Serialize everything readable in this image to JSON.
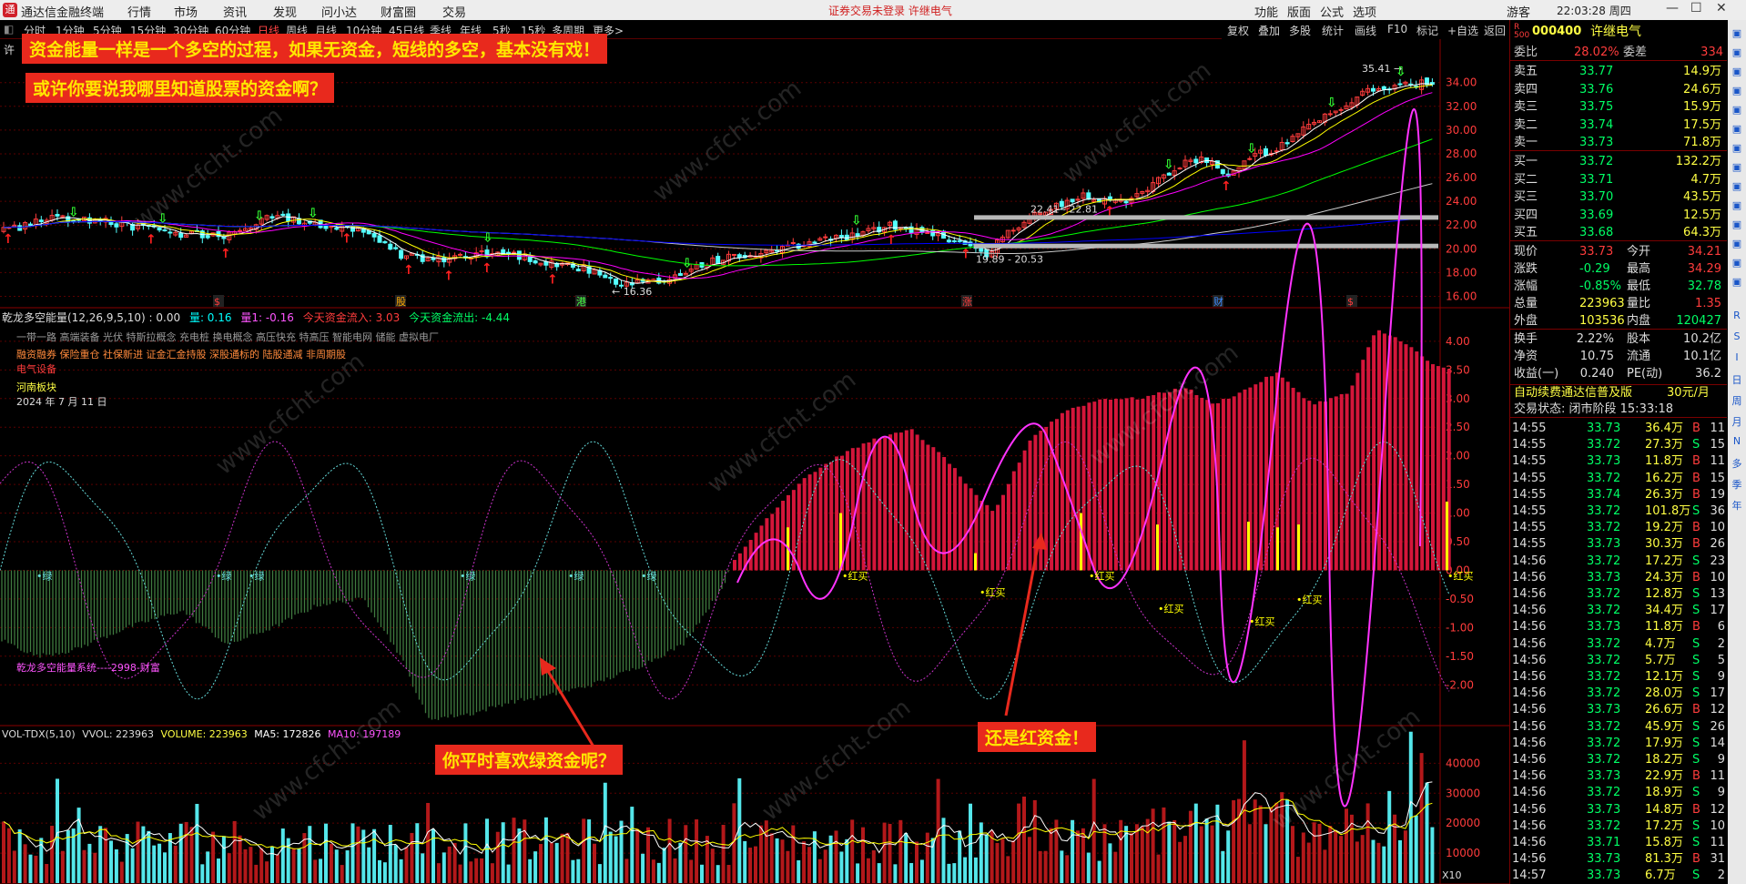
{
  "app": {
    "name": "通达信金融终端",
    "notice": "证券交易未登录  许继电气",
    "clock": "22:03:28 周四"
  },
  "menu": [
    "行情",
    "市场",
    "资讯",
    "发现",
    "问小达",
    "财富圈",
    "交易"
  ],
  "right_menu": [
    "功能",
    "版面",
    "公式",
    "选项",
    "游客"
  ],
  "periods": [
    "分时",
    "1分钟",
    "5分钟",
    "15分钟",
    "30分钟",
    "60分钟",
    "日线",
    "周线",
    "月线",
    "10分钟",
    "45日线",
    "季线",
    "年线",
    "5秒",
    "15秒",
    "多周期",
    "更多>"
  ],
  "active_period": "日线",
  "toolbar": [
    "复权",
    "叠加",
    "多股",
    "统计",
    "画线",
    "F10",
    "标记",
    "+自选",
    "返回"
  ],
  "annotations": {
    "a1": "资金能量一样是一个多空的过程，如果无资金，短线的多空，基本没有戏！",
    "a2": "或许你要说我哪里知道股票的资金啊？",
    "a3": "你平时喜欢绿资金呢？",
    "a4": "还是红资金！"
  },
  "main_chart": {
    "stock_short": "许",
    "hi_label": "35.41",
    "lo_label": "16.36",
    "range1": "22.41 - 22.81",
    "range2": "19.89 - 20.53",
    "y_ticks": [
      "34.00",
      "32.00",
      "30.00",
      "28.00",
      "26.00",
      "24.00",
      "22.00",
      "20.00",
      "18.00",
      "16.00"
    ],
    "y_range": [
      15.5,
      36.2
    ],
    "event_marks": [
      "$",
      "股",
      "港",
      "涨",
      "财",
      "$"
    ],
    "colors": {
      "up": "#ff3c3c",
      "down": "#54ffff",
      "ma5": "#ffffff",
      "ma10": "#ffff00",
      "ma20": "#ff00ff",
      "ma60": "#00ff00",
      "ma120": "#cccccc",
      "ma250": "#0000ff"
    }
  },
  "indicator": {
    "title": "乾龙多空能量(12,26,9,5,10)",
    "v0": ": 0.00",
    "v_liang": "量: 0.16",
    "v_liang1": "量1: -0.16",
    "inflow": "今天资金流入: 3.03",
    "outflow": "今天资金流出: -4.44",
    "concepts1": "一带一路 高端装备 光伏 特斯拉概念 充电桩 换电概念 高压快充 特高压 智能电网 储能 虚拟电厂",
    "concepts2": "融资融券 保险重仓 社保新进 证金汇金持股 深股通标的 陆股通减 非周期股",
    "concepts3": "电气设备",
    "sector": "河南板块",
    "date": "2024 年 7 月 11 日",
    "system_label": "乾龙多空能量系统----2998-财富",
    "green_label": "绿",
    "red_label": "红买",
    "y_ticks": [
      "4.00",
      "3.50",
      "3.00",
      "2.50",
      "2.00",
      "1.50",
      "1.00",
      "0.50",
      "0.00",
      "-0.50",
      "-1.00",
      "-1.50",
      "-2.00"
    ],
    "y_range": [
      -2.6,
      4.3
    ]
  },
  "volume": {
    "title": "VOL-TDX(5,10)",
    "vvol": "VVOL: 223963",
    "volume": "VOLUME: 223963",
    "ma5": "MA5: 172826",
    "ma10": "MA10: 197189",
    "y_ticks": [
      "40000",
      "30000",
      "20000",
      "10000"
    ],
    "unit": "X10",
    "y_range": [
      0,
      48000
    ]
  },
  "quote": {
    "code": "000400",
    "name": "许继电气",
    "wb_label": "委比",
    "wb": "28.02%",
    "wc_label": "委差",
    "wc": "334",
    "asks": [
      {
        "label": "卖五",
        "price": "33.77",
        "vol": "14.9万"
      },
      {
        "label": "卖四",
        "price": "33.76",
        "vol": "24.6万"
      },
      {
        "label": "卖三",
        "price": "33.75",
        "vol": "15.9万"
      },
      {
        "label": "卖二",
        "price": "33.74",
        "vol": "17.5万"
      },
      {
        "label": "卖一",
        "price": "33.73",
        "vol": "71.8万"
      }
    ],
    "bids": [
      {
        "label": "买一",
        "price": "33.72",
        "vol": "132.2万"
      },
      {
        "label": "买二",
        "price": "33.71",
        "vol": "4.7万"
      },
      {
        "label": "买三",
        "price": "33.70",
        "vol": "43.5万"
      },
      {
        "label": "买四",
        "price": "33.69",
        "vol": "12.5万"
      },
      {
        "label": "买五",
        "price": "33.68",
        "vol": "64.3万"
      }
    ],
    "stats": [
      {
        "l1": "现价",
        "v1": "33.73",
        "l2": "今开",
        "v2": "34.21"
      },
      {
        "l1": "涨跌",
        "v1": "-0.29",
        "l2": "最高",
        "v2": "34.29"
      },
      {
        "l1": "涨幅",
        "v1": "-0.85%",
        "l2": "最低",
        "v2": "32.78"
      },
      {
        "l1": "总量",
        "v1": "223963",
        "l2": "量比",
        "v2": "1.35"
      },
      {
        "l1": "外盘",
        "v1": "103536",
        "l2": "内盘",
        "v2": "120427"
      }
    ],
    "stats2": [
      {
        "l1": "换手",
        "v1": "2.22%",
        "l2": "股本",
        "v2": "10.2亿"
      },
      {
        "l1": "净资",
        "v1": "10.75",
        "l2": "流通",
        "v2": "10.1亿"
      },
      {
        "l1": "收益(一)",
        "v1": "0.240",
        "l2": "PE(动)",
        "v2": "36.2"
      }
    ],
    "promo": "自动续费通达信普及版",
    "promo_price": "30元/月",
    "trade_status": "交易状态: 闭市阶段 15:33:18",
    "ticks": [
      [
        "14:55",
        "33.73",
        "36.4万",
        "B",
        "11"
      ],
      [
        "14:55",
        "33.72",
        "27.3万",
        "S",
        "15"
      ],
      [
        "14:55",
        "33.73",
        "11.8万",
        "B",
        "11"
      ],
      [
        "14:55",
        "33.72",
        "16.2万",
        "B",
        "15"
      ],
      [
        "14:55",
        "33.74",
        "26.3万",
        "B",
        "19"
      ],
      [
        "14:55",
        "33.72",
        "101.8万",
        "S",
        "36"
      ],
      [
        "14:55",
        "33.72",
        "19.2万",
        "B",
        "10"
      ],
      [
        "14:55",
        "33.73",
        "30.3万",
        "B",
        "26"
      ],
      [
        "14:56",
        "33.72",
        "17.2万",
        "S",
        "23"
      ],
      [
        "14:56",
        "33.73",
        "24.3万",
        "B",
        "10"
      ],
      [
        "14:56",
        "33.72",
        "12.8万",
        "S",
        "13"
      ],
      [
        "14:56",
        "33.72",
        "34.4万",
        "S",
        "17"
      ],
      [
        "14:56",
        "33.73",
        "11.8万",
        "B",
        "6"
      ],
      [
        "14:56",
        "33.72",
        "4.7万",
        "S",
        "2"
      ],
      [
        "14:56",
        "33.72",
        "5.7万",
        "S",
        "5"
      ],
      [
        "14:56",
        "33.72",
        "12.1万",
        "S",
        "9"
      ],
      [
        "14:56",
        "33.72",
        "28.0万",
        "S",
        "17"
      ],
      [
        "14:56",
        "33.73",
        "26.6万",
        "B",
        "12"
      ],
      [
        "14:56",
        "33.72",
        "45.9万",
        "S",
        "26"
      ],
      [
        "14:56",
        "33.72",
        "17.9万",
        "S",
        "14"
      ],
      [
        "14:56",
        "33.72",
        "18.2万",
        "S",
        "9"
      ],
      [
        "14:56",
        "33.73",
        "22.9万",
        "B",
        "11"
      ],
      [
        "14:56",
        "33.72",
        "18.9万",
        "S",
        "9"
      ],
      [
        "14:56",
        "33.73",
        "14.8万",
        "B",
        "12"
      ],
      [
        "14:56",
        "33.72",
        "17.2万",
        "S",
        "10"
      ],
      [
        "14:56",
        "33.71",
        "15.8万",
        "S",
        "11"
      ],
      [
        "14:56",
        "33.73",
        "81.3万",
        "B",
        "31"
      ],
      [
        "14:57",
        "33.73",
        "6.7万",
        "S",
        "2"
      ]
    ]
  },
  "sidebar_items": [
    "R",
    "S",
    "I",
    "日",
    "周",
    "月",
    "N",
    "多",
    "季",
    "年"
  ],
  "watermark": "www.cfcht.com"
}
